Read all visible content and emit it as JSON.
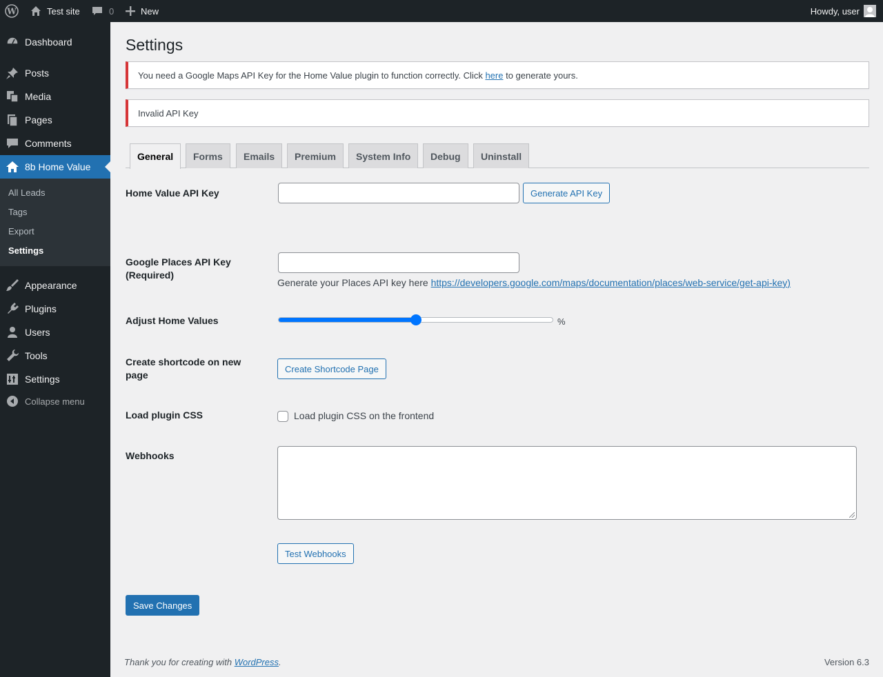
{
  "adminbar": {
    "site_name": "Test site",
    "comments_count": "0",
    "new_label": "New",
    "howdy": "Howdy, user"
  },
  "sidebar": {
    "items": [
      {
        "label": "Dashboard",
        "icon": "dashboard-icon"
      },
      {
        "label": "Posts",
        "icon": "pin-icon"
      },
      {
        "label": "Media",
        "icon": "media-icon"
      },
      {
        "label": "Pages",
        "icon": "pages-icon"
      },
      {
        "label": "Comments",
        "icon": "comments-icon"
      },
      {
        "label": "8b Home Value",
        "icon": "home-icon"
      },
      {
        "label": "Appearance",
        "icon": "brush-icon"
      },
      {
        "label": "Plugins",
        "icon": "plugin-icon"
      },
      {
        "label": "Users",
        "icon": "user-icon"
      },
      {
        "label": "Tools",
        "icon": "wrench-icon"
      },
      {
        "label": "Settings",
        "icon": "settings-icon"
      }
    ],
    "submenu": [
      "All Leads",
      "Tags",
      "Export",
      "Settings"
    ],
    "collapse_label": "Collapse menu"
  },
  "page": {
    "title": "Settings"
  },
  "notices": {
    "maps": {
      "before": "You need a Google Maps API Key for the Home Value plugin to function correctly. Click ",
      "link": "here",
      "after": " to generate yours."
    },
    "invalid": "Invalid API Key"
  },
  "tabs": [
    "General",
    "Forms",
    "Emails",
    "Premium",
    "System Info",
    "Debug",
    "Uninstall"
  ],
  "active_tab": "General",
  "form": {
    "api_key_label": "Home Value API Key",
    "api_key_value": "",
    "generate_button": "Generate API Key",
    "places_label_1": "Google Places API Key",
    "places_label_2": "(Required)",
    "places_value": "",
    "places_desc": "Generate your Places API key here ",
    "places_link": "https://developers.google.com/maps/documentation/places/web-service/get-api-key)",
    "adjust_label": "Adjust Home Values",
    "adjust_value_fraction": 0.5,
    "adjust_unit": "%",
    "shortcode_label_1": "Create shortcode on new",
    "shortcode_label_2": "page",
    "shortcode_button": "Create Shortcode Page",
    "css_label": "Load plugin CSS",
    "css_checkbox_label": "Load plugin CSS on the frontend",
    "css_checked": false,
    "webhooks_label": "Webhooks",
    "webhooks_value": "",
    "test_webhooks_button": "Test Webhooks",
    "save_button": "Save Changes"
  },
  "footer": {
    "thanks_before": "Thank you for creating with ",
    "thanks_link": "WordPress",
    "thanks_after": ".",
    "version": "Version 6.3"
  },
  "colors": {
    "admin_bg": "#1d2327",
    "accent": "#2271b1",
    "error": "#d63638",
    "slider": "#0075ff"
  }
}
